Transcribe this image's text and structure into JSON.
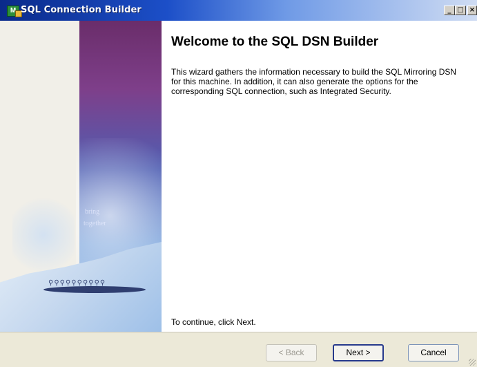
{
  "window": {
    "title": "SQL Connection Builder",
    "icon": "app-icon",
    "controls": {
      "minimize": "_",
      "maximize": "□",
      "close": "×"
    }
  },
  "sidebar": {
    "art_text_1": "bring",
    "art_text_2": "together"
  },
  "content": {
    "heading": "Welcome to the SQL DSN Builder",
    "description": "This wizard gathers the information necessary to build the SQL Mirroring DSN for this machine.  In addition, it can also generate the options for the corresponding SQL connection, such as Integrated Security.",
    "continue_text": "To continue, click Next."
  },
  "buttons": {
    "back": "< Back",
    "next": "Next >",
    "cancel": "Cancel"
  },
  "colors": {
    "titlebar_start": "#0a2a8a",
    "titlebar_end": "#cfdcf3",
    "footer_bg": "#ece9d8",
    "art_purple": "#7e3f8a",
    "art_blue": "#7da6dd"
  }
}
